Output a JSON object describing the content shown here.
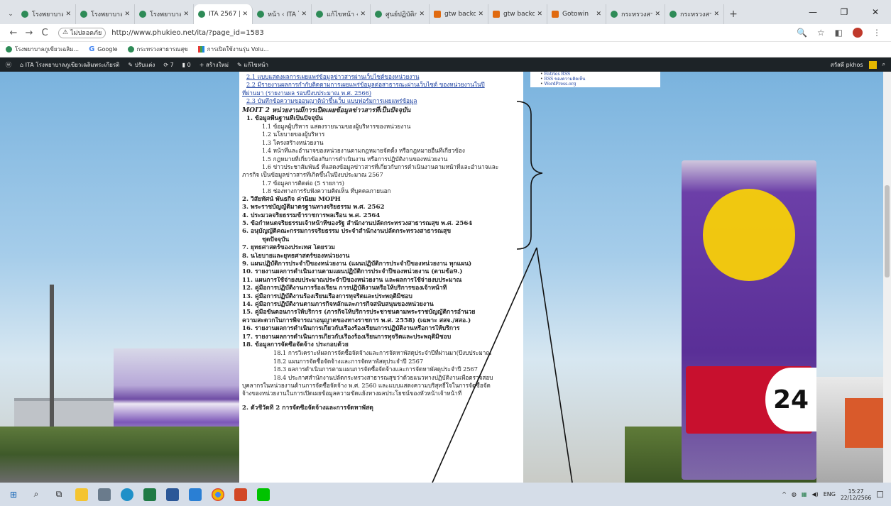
{
  "browser": {
    "tabs": [
      {
        "title": "โรงพยาบาลภูเ",
        "favicon": "site-icon"
      },
      {
        "title": "โรงพยาบาลภูเ",
        "favicon": "site-icon"
      },
      {
        "title": "โรงพยาบาลภูเ",
        "favicon": "site-icon"
      },
      {
        "title": "ITA 2567 | IT",
        "favicon": "site-icon",
        "active": true
      },
      {
        "title": "หน้า ‹ ITA โร",
        "favicon": "site-icon"
      },
      {
        "title": "แก้ไขหน้า ‹ IT",
        "favicon": "site-icon"
      },
      {
        "title": "ศูนย์ปฏิบัติการ",
        "favicon": "site-icon"
      },
      {
        "title": "gtw backoffi",
        "favicon": "go-icon"
      },
      {
        "title": "gtw backoffi",
        "favicon": "go-icon"
      },
      {
        "title": "Gotowin",
        "favicon": "go-icon"
      },
      {
        "title": "กระทรวงสาธา",
        "favicon": "site-icon"
      },
      {
        "title": "กระทรวงสาธา",
        "favicon": "site-icon"
      }
    ],
    "new_tab": "+",
    "tab_menu": "⌄",
    "window_controls": {
      "minimize": "—",
      "maximize": "❐",
      "close": "✕"
    },
    "nav": {
      "back": "←",
      "forward": "→",
      "reload": "C"
    },
    "security_label": "ไม่ปลอดภัย",
    "url": "http://www.phukieo.net/ita/?page_id=1583",
    "right_icons": {
      "zoom": "🔍",
      "star": "☆",
      "sidepanel": "◧",
      "menu": "⋮"
    },
    "bookmarks": [
      {
        "label": "โรงพยาบาลภูเขียวเฉลิม...",
        "icon": "site-icon"
      },
      {
        "label": "Google",
        "icon": "google-icon"
      },
      {
        "label": "กระทรวงสาธารณสุข",
        "icon": "site-icon"
      },
      {
        "label": "การเปิดใช้งานรุ่น Volu...",
        "icon": "grid-icon"
      }
    ]
  },
  "wp_admin_bar": {
    "site": "ITA โรงพยาบาลภูเขียวเฉลิมพระเกียรติ",
    "customize": "ปรับแต่ง",
    "updates": "7",
    "comments": "0",
    "new": "สร้างใหม่",
    "edit": "แก้ไขหน้า",
    "user": "สวัสดี pkhos"
  },
  "sidebar_links": [
    "Entries RSS",
    "RSS ของความคิดเห็น",
    "WordPress.org"
  ],
  "content": [
    {
      "t": "2.1 แบบแสดงผลการเผยแพร่ข้อมูลข่าวสารผ่านเว็บไซต์ของหน่วยงาน",
      "s": "link i1"
    },
    {
      "t": "2.2 มีรายงานผลการกำกับติดตามการเผยแพร่ข้อมูลต่อสาธารณะผ่านเว็บไซต์ ของหน่วยงานในปี",
      "s": "link i1"
    },
    {
      "t": "ที่ผ่านมา (รายงานผล รอบปีงบประมาณ พ.ศ. 2566)",
      "s": "link"
    },
    {
      "t": "2.3 บันทึกข้อความขออนุญาตินำขึ้นเว็บ แบบฟอร์มการเผยแพร่ข้อมูล",
      "s": "link i1"
    },
    {
      "t": "MOIT 2 หน่วยงานมีการเปิดเผยข้อมูลข่าวสารที่เป็นปัจจุบัน",
      "s": "moit"
    },
    {
      "t": "1. ข้อมูลพื้นฐานที่เป็นปัจจุบัน",
      "s": "h i1"
    },
    {
      "t": "1.1 ข้อมูลผู้บริหาร แสดงรายนามของผู้บริหารของหน่วยงาน",
      "s": "i2"
    },
    {
      "t": "1.2 นโยบายของผู้บริหาร",
      "s": "i2"
    },
    {
      "t": "1.3 โครงสร้างหน่วยงาน",
      "s": "i2"
    },
    {
      "t": "1.4 หน้าที่และอำนาจของหน่วยงานตามกฎหมายจัดตั้ง หรือกฎหมายอื่นที่เกี่ยวข้อง",
      "s": "i2"
    },
    {
      "t": "1.5 กฎหมายที่เกี่ยวข้องกับการดำเนินงาน หรือการปฏิบัติงานของหน่วยงาน",
      "s": "i2"
    },
    {
      "t": "1.6 ข่าวประชาสัมพันธ์ ที่แสดงข้อมูลข่าวสารที่เกี่ยวกับการดำเนินงานตามหน้าที่และอำนาจและ",
      "s": "i2"
    },
    {
      "t": "ภารกิจ เป็นข้อมูลข่าวสารที่เกิดขึ้นในปีงบประมาณ 2567",
      "s": ""
    },
    {
      "t": "1.7 ข้อมูลการติดต่อ (5 รายการ)",
      "s": "i2"
    },
    {
      "t": "1.8 ช่องทางการรับฟังความคิดเห็น ที่บุคคลภายนอก",
      "s": "i2"
    },
    {
      "t": "2. วิสัยทัศน์ พันธกิจ ค่านิยม MOPH",
      "s": "h"
    },
    {
      "t": "3. พระราชบัญญัติมาตรฐานทางจริยธรรม พ.ศ. 2562",
      "s": "h"
    },
    {
      "t": "4. ประมวลจริยธรรมข้าราชการพลเรือน พ.ศ. 2564",
      "s": "h"
    },
    {
      "t": "5. ข้อกำหนดจริยธรรมเจ้าหน้าที่ของรัฐ สำนักงานปลัดกระทรวงสาธารณสุข พ.ศ. 2564",
      "s": "h"
    },
    {
      "t": "6. อนุบัญญัติคณะกรรมการจริยธรรม ประจำสำนักงานปลัดกระทรวงสาธารณสุข",
      "s": "h"
    },
    {
      "t": "ชุดปัจจุบัน",
      "s": "h i2"
    },
    {
      "t": "7. ยุทธศาสตร์ของประเทศ โดยรวม",
      "s": "h"
    },
    {
      "t": "8. นโยบายและยุทธศาสตร์ของหน่วยงาน",
      "s": "h"
    },
    {
      "t": "9. แผนปฏิบัติการประจำปีของหน่วยงาน (แผนปฏิบัติการประจำปีของหน่วยงาน ทุกแผน)",
      "s": "h"
    },
    {
      "t": "10. รายงานผลการดำเนินงานตามแผนปฏิบัติการประจำปีของหน่วยงาน (ตามข้อ9.)",
      "s": "h"
    },
    {
      "t": "11. แผนการใช้จ่ายงบประมาณประจำปีของหน่วยงาน และผลการใช้จ่ายงบประมาณ",
      "s": "h"
    },
    {
      "t": "12. คู่มือการปฏิบัติงานการร้องเรียน การปฏิบัติงานหรือให้บริการของเจ้าหน้าที่",
      "s": "h"
    },
    {
      "t": "13. คู่มือการปฏิบัติงานร้องเรียนเรื่องการทุจริตและประพฤติมิชอบ",
      "s": "h"
    },
    {
      "t": "14. คู่มือการปฏิบัติงานตามภารกิจหลักและภารกิจสนับสนุนของหน่วยงาน",
      "s": "h"
    },
    {
      "t": "15. คู่มือขั้นตอนการให้บริการ (ภารกิจให้บริการประชาชนตามพระราชบัญญัติการอำนวย",
      "s": "h"
    },
    {
      "t": "ความสะดวกในการพิจารณาอนุญาตของทางราชการ พ.ศ. 2558) (เฉพาะ สสจ./สสอ.)",
      "s": "h"
    },
    {
      "t": "16. รายงานผลการดำเนินการเกี่ยวกับเรื่องร้องเรียนการปฏิบัติงานหรือการให้บริการ",
      "s": "h"
    },
    {
      "t": "17. รายงานผลการดำเนินการเกี่ยวกับเรื่องร้องเรียนการทุจริตและประพฤติมิชอบ",
      "s": "h"
    },
    {
      "t": "18. ข้อมูลการจัดซื้อจัดจ้าง ประกอบด้วย",
      "s": "h"
    },
    {
      "t": "18.1 การวิเคราะห์ผลการจัดซื้อจัดจ้างและการจัดหาพัสดุประจำปีที่ผ่านมา(ปีงบประมาณ",
      "s": "i3"
    },
    {
      "t": "18.2 แผนการจัดซื้อจัดจ้างและการจัดหาพัสดุประจำปี 2567",
      "s": "i3"
    },
    {
      "t": "18.3 ผลการดำเนินการตามแผนการจัดซื้อจัดจ้างและการจัดหาพัสดุประจำปี 2567",
      "s": "i3"
    },
    {
      "t": "18.4 ประกาศสำนักงานปลัดกระทรวงสาธารณสุขว่าด้วยแนวทางปฏิบัติงานเพื่อตรวจสอบ",
      "s": "i3"
    },
    {
      "t": "บุคลากรในหน่วยงานด้านการจัดซื้อจัดจ้าง พ.ศ. 2560 และแบบแสดงความบริสุทธิ์ใจในการจัดซื้อจัด",
      "s": ""
    },
    {
      "t": "จ้างของหน่วยงานในการเปิดเผยข้อมูลความขัดแย้งทางผลประโยชน์ของหัวหน้าเจ้าหน้าที่",
      "s": ""
    },
    {
      "t": "",
      "s": "gap"
    },
    {
      "t": "2. ตัวชี้วัดที่ 2 การจัดซื้อจัดจ้างและการจัดหาพัสดุ",
      "s": "h"
    }
  ],
  "sign_text": "24",
  "taskbar": {
    "start": "⊞",
    "search": "⌕",
    "taskview": "⧉",
    "tray_arrow": "^",
    "lang": "ENG",
    "time": "15:27",
    "date": "22/12/2566",
    "notify": "☐"
  }
}
